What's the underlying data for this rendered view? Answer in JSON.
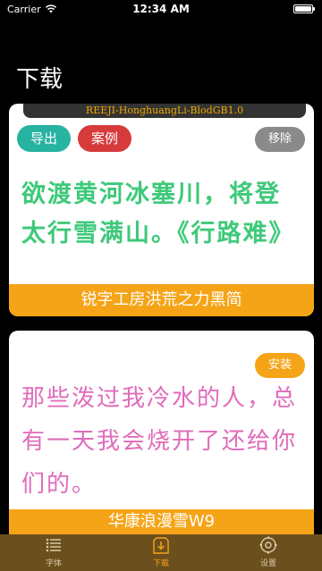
{
  "status": {
    "carrier": "Carrier",
    "time": "12:34 AM"
  },
  "page_title": "下载",
  "cards": [
    {
      "font_id": "REEJI-HonghuangLi-BlodGB1.0",
      "export_label": "导出",
      "example_label": "案例",
      "remove_label": "移除",
      "sample": "欲渡黄河冰塞川，将登太行雪满山。《行路难》",
      "font_name": "锐字工房洪荒之力黑简"
    },
    {
      "install_label": "安装",
      "sample": "那些泼过我冷水的人，总有一天我会烧开了还给你们的。",
      "font_name": "华康浪漫雪W9"
    }
  ],
  "tabs": [
    {
      "label": "字体",
      "icon": "list-icon"
    },
    {
      "label": "下载",
      "icon": "download-icon"
    },
    {
      "label": "设置",
      "icon": "gear-icon"
    }
  ],
  "colors": {
    "accent": "#f5a417",
    "export": "#26b3a0",
    "example": "#d63b3b",
    "remove": "#8a8a8a",
    "sample1": "#3ec97a",
    "sample2": "#e06bbb",
    "tabbar": "#6b4f1d"
  }
}
